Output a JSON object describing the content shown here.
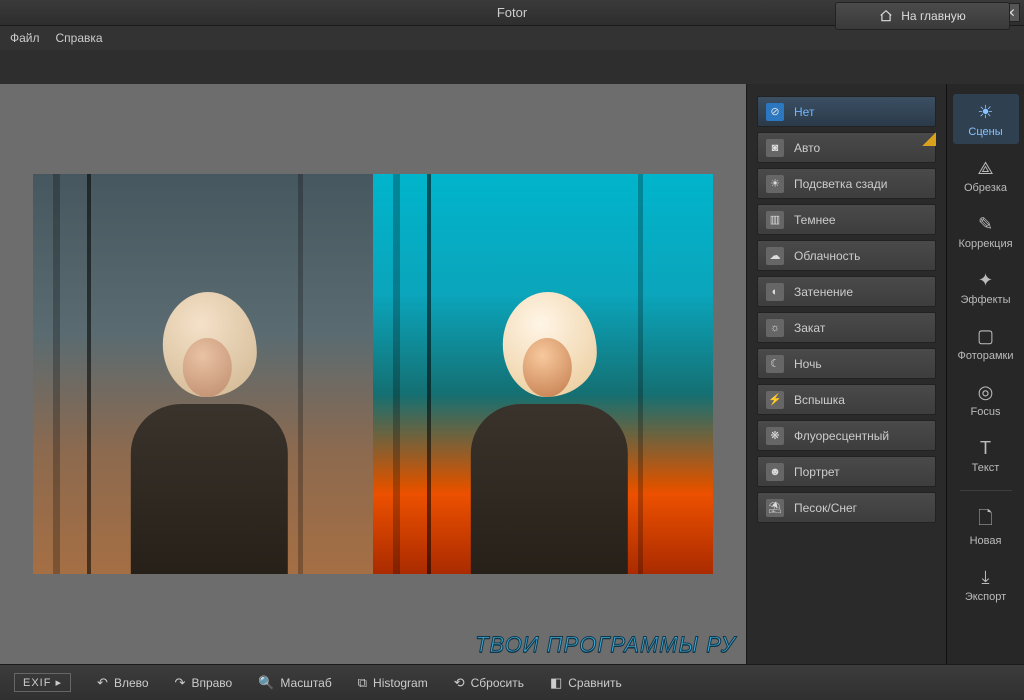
{
  "titlebar": {
    "title": "Fotor"
  },
  "menubar": {
    "file": "Файл",
    "help": "Справка",
    "home_button": "На главную"
  },
  "scenes": {
    "items": [
      {
        "label": "Нет",
        "selected": true,
        "ribbon": false,
        "icon": "⊘"
      },
      {
        "label": "Авто",
        "selected": false,
        "ribbon": true,
        "icon": "◙"
      },
      {
        "label": "Подсветка сзади",
        "selected": false,
        "ribbon": false,
        "icon": "☀"
      },
      {
        "label": "Темнее",
        "selected": false,
        "ribbon": false,
        "icon": "▥"
      },
      {
        "label": "Облачность",
        "selected": false,
        "ribbon": false,
        "icon": "☁"
      },
      {
        "label": "Затенение",
        "selected": false,
        "ribbon": false,
        "icon": "◐"
      },
      {
        "label": "Закат",
        "selected": false,
        "ribbon": false,
        "icon": "☼"
      },
      {
        "label": "Ночь",
        "selected": false,
        "ribbon": false,
        "icon": "☾"
      },
      {
        "label": "Вспышка",
        "selected": false,
        "ribbon": false,
        "icon": "⚡"
      },
      {
        "label": "Флуоресцентный",
        "selected": false,
        "ribbon": false,
        "icon": "❋"
      },
      {
        "label": "Портрет",
        "selected": false,
        "ribbon": false,
        "icon": "☻"
      },
      {
        "label": "Песок/Снег",
        "selected": false,
        "ribbon": false,
        "icon": "⛱"
      }
    ]
  },
  "tools": {
    "items": [
      {
        "label": "Сцены",
        "glyph": "☀",
        "selected": true
      },
      {
        "label": "Обрезка",
        "glyph": "⟁",
        "selected": false
      },
      {
        "label": "Коррекция",
        "glyph": "✎",
        "selected": false
      },
      {
        "label": "Эффекты",
        "glyph": "✦",
        "selected": false
      },
      {
        "label": "Фоторамки",
        "glyph": "▢",
        "selected": false
      },
      {
        "label": "Focus",
        "glyph": "◎",
        "selected": false
      },
      {
        "label": "Текст",
        "glyph": "T",
        "selected": false
      }
    ],
    "lower": [
      {
        "label": "Новая",
        "glyph": "🗋"
      },
      {
        "label": "Экспорт",
        "glyph": "⤓"
      }
    ]
  },
  "footer": {
    "exif": "EXIF ▸",
    "rotate_left": "Влево",
    "rotate_right": "Вправо",
    "zoom": "Масштаб",
    "histogram": "Histogram",
    "reset": "Сбросить",
    "compare": "Сравнить"
  },
  "watermark": "ТВОИ ПРОГРАММЫ РУ"
}
